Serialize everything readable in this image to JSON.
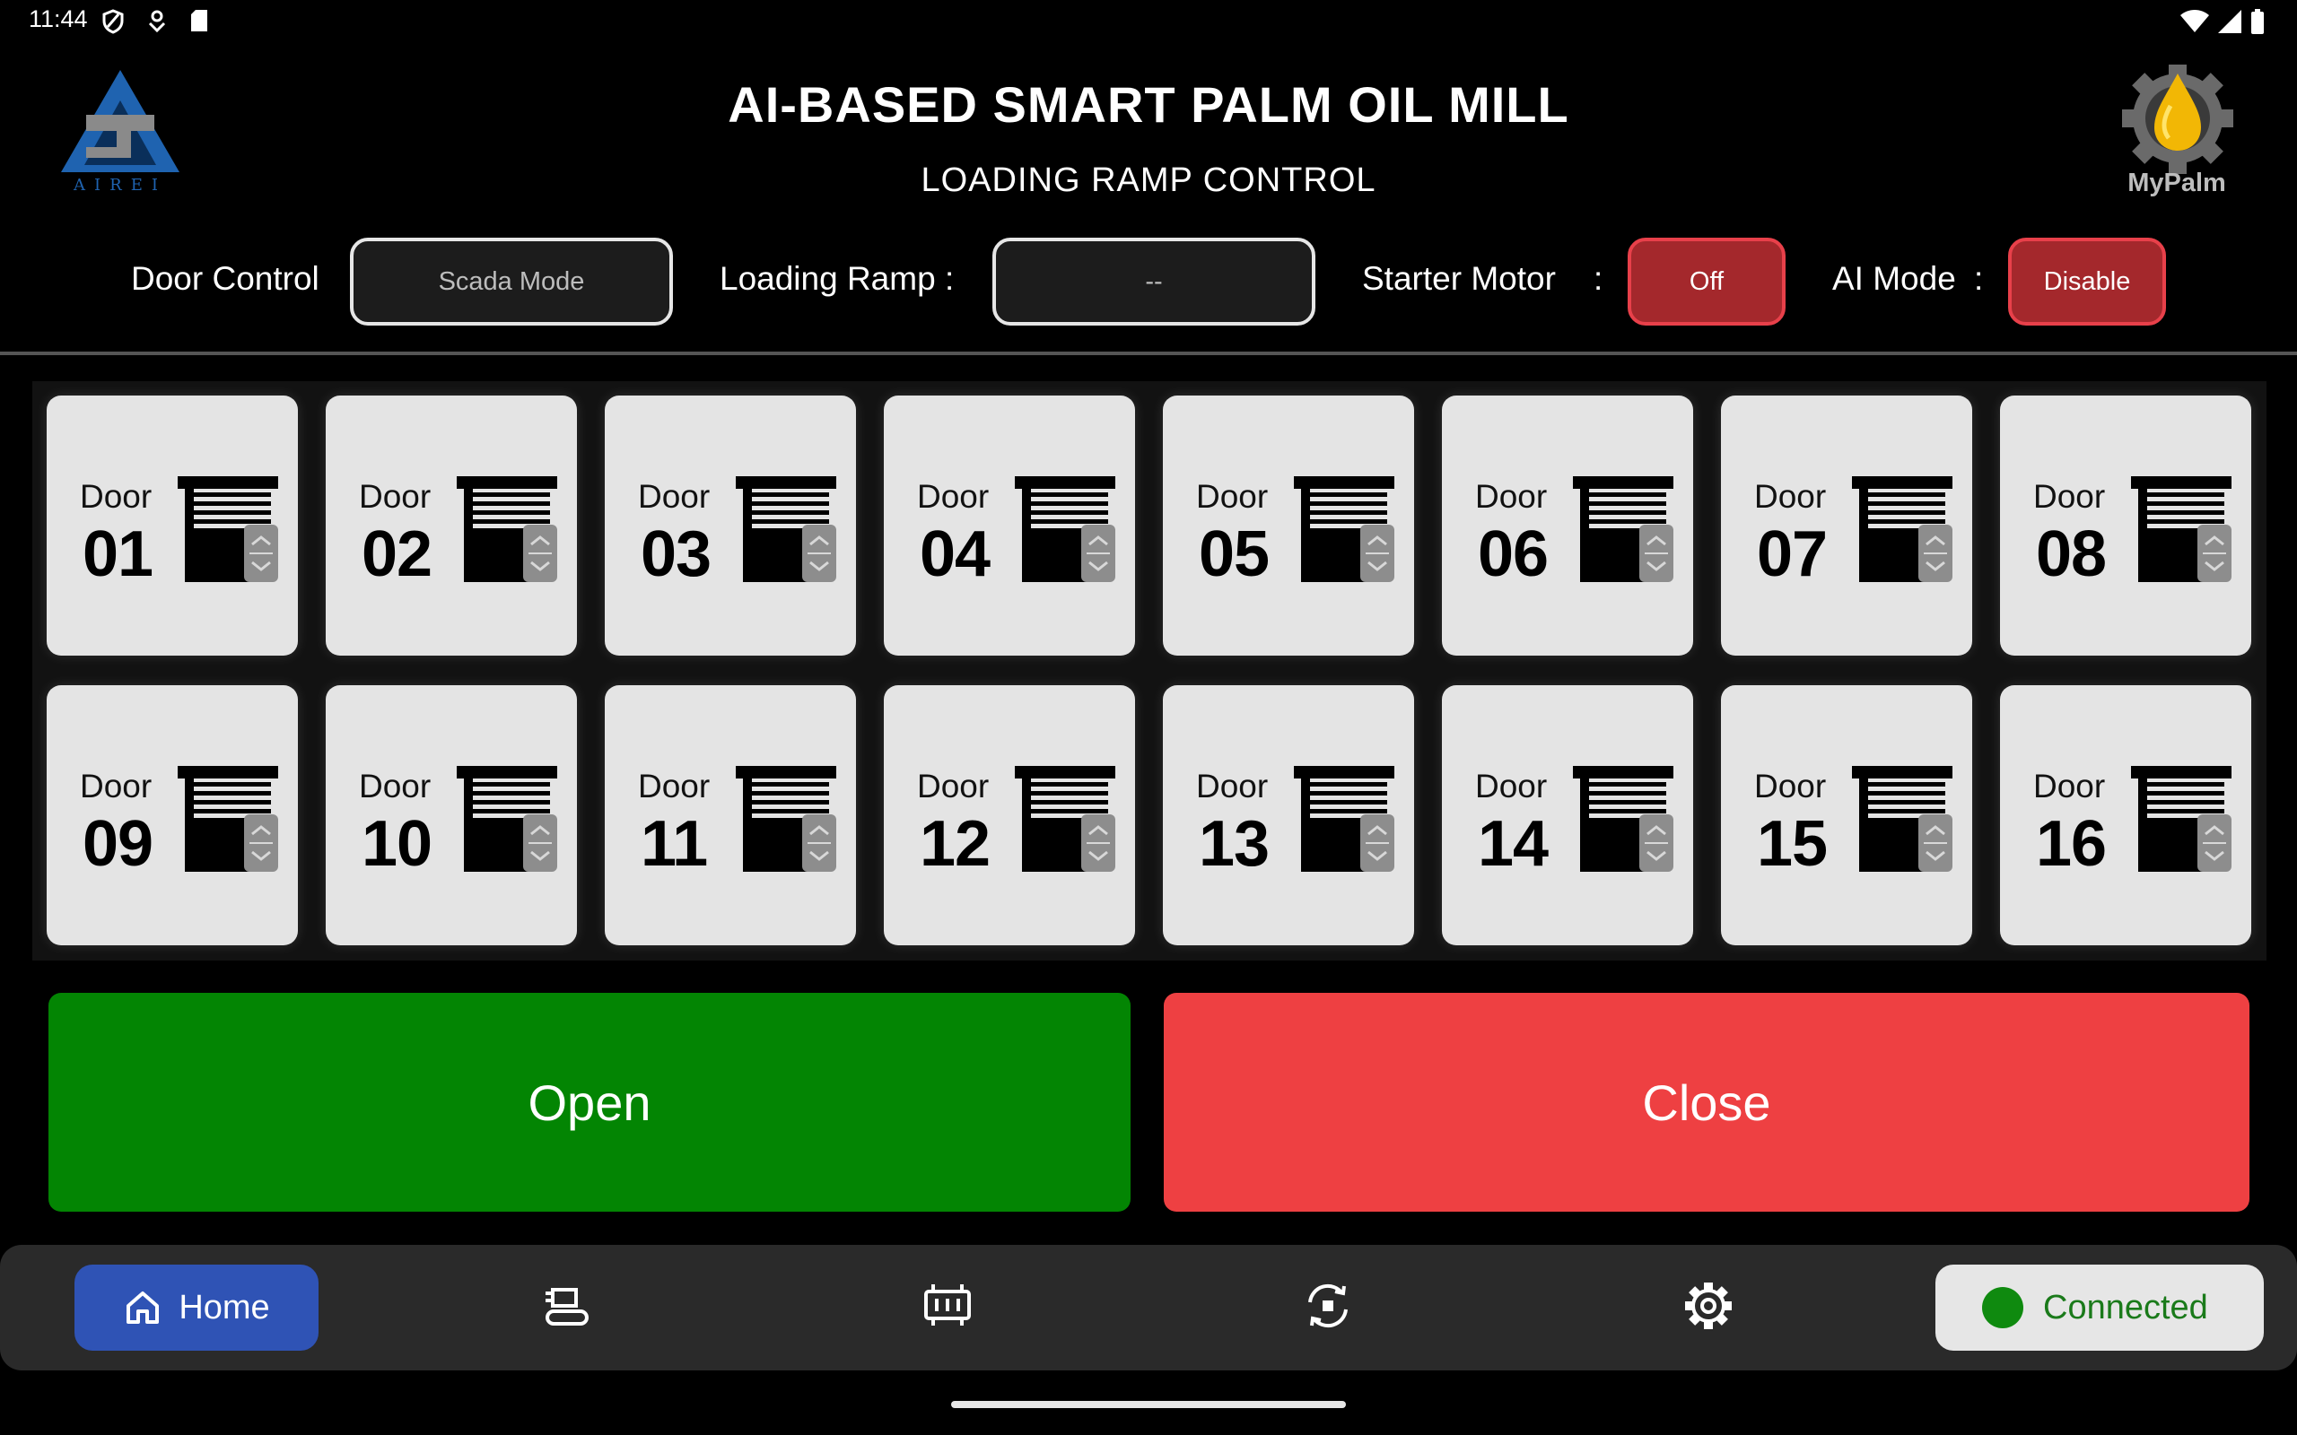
{
  "status_bar": {
    "time": "11:44"
  },
  "header": {
    "title": "AI-BASED SMART PALM OIL MILL",
    "subtitle": "LOADING RAMP CONTROL",
    "left_logo_text": "A I R E I",
    "right_logo_text": "MyPalm"
  },
  "controls": {
    "door_control_label": "Door Control",
    "door_control_value": "Scada Mode",
    "loading_ramp_label": "Loading Ramp :",
    "loading_ramp_value": "--",
    "starter_motor_label": "Starter Motor",
    "starter_motor_colon": ":",
    "starter_motor_value": "Off",
    "ai_mode_label": "AI Mode",
    "ai_mode_colon": ":",
    "ai_mode_value": "Disable"
  },
  "doors": [
    {
      "label": "Door",
      "number": "01"
    },
    {
      "label": "Door",
      "number": "02"
    },
    {
      "label": "Door",
      "number": "03"
    },
    {
      "label": "Door",
      "number": "04"
    },
    {
      "label": "Door",
      "number": "05"
    },
    {
      "label": "Door",
      "number": "06"
    },
    {
      "label": "Door",
      "number": "07"
    },
    {
      "label": "Door",
      "number": "08"
    },
    {
      "label": "Door",
      "number": "09"
    },
    {
      "label": "Door",
      "number": "10"
    },
    {
      "label": "Door",
      "number": "11"
    },
    {
      "label": "Door",
      "number": "12"
    },
    {
      "label": "Door",
      "number": "13"
    },
    {
      "label": "Door",
      "number": "14"
    },
    {
      "label": "Door",
      "number": "15"
    },
    {
      "label": "Door",
      "number": "16"
    }
  ],
  "actions": {
    "open_label": "Open",
    "close_label": "Close"
  },
  "nav": {
    "home_label": "Home",
    "connected_label": "Connected",
    "icons": [
      "home-icon",
      "conveyor-icon",
      "memory-chip-icon",
      "sync-icon",
      "gear-icon"
    ]
  },
  "colors": {
    "open": "#038503",
    "close": "#ee4042",
    "accent": "#2f53b5",
    "status_red": "#a4282c"
  }
}
